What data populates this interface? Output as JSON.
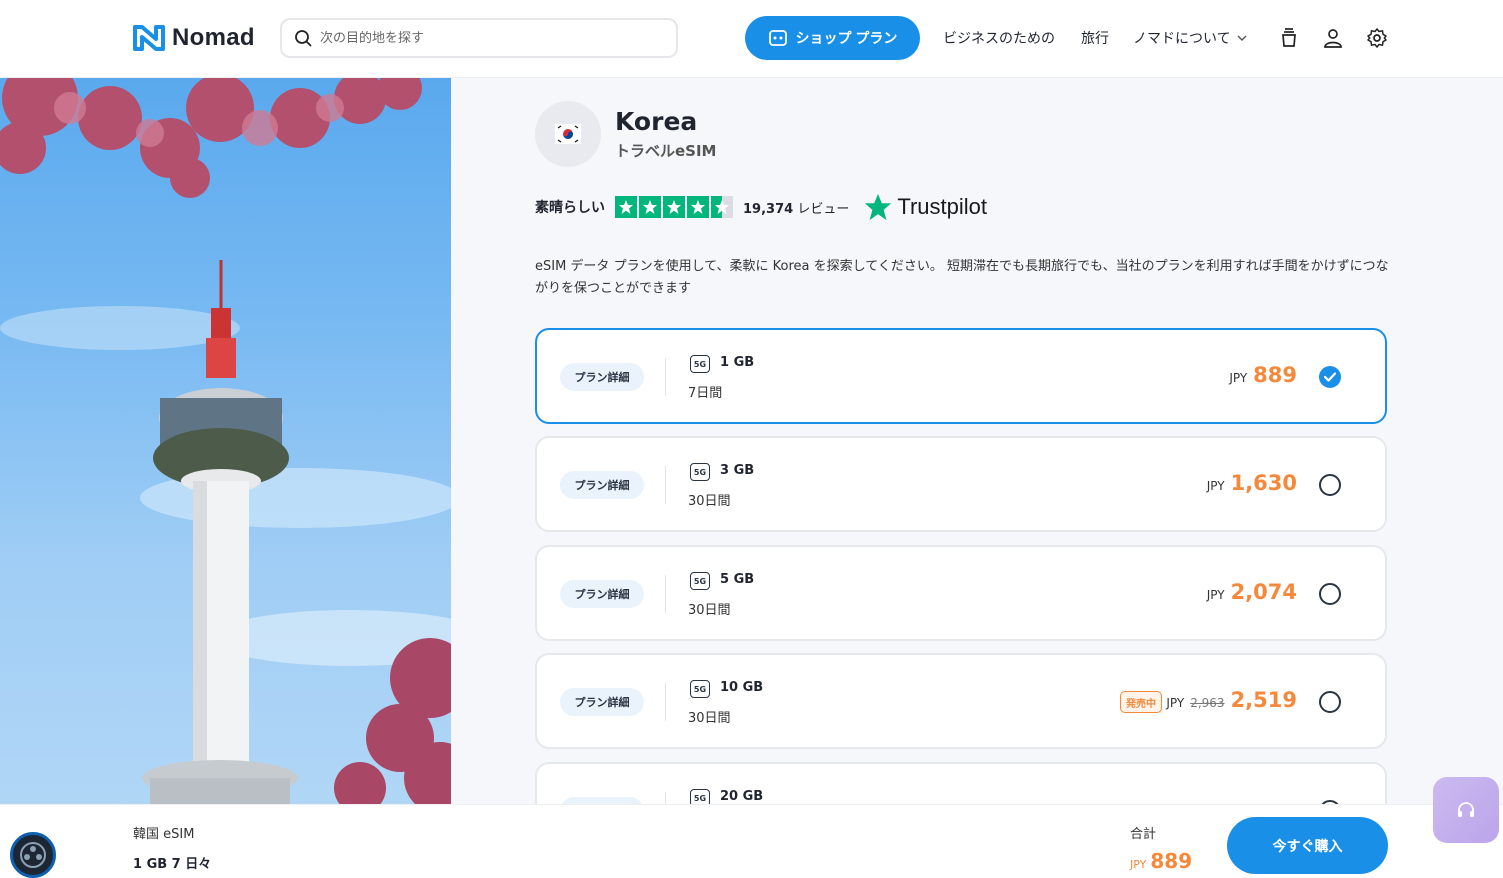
{
  "header": {
    "brand": "Nomad",
    "search_placeholder": "次の目的地を探す",
    "shop_plans_label": "ショップ プラン",
    "nav_business": "ビジネスのための",
    "nav_travel": "旅行",
    "nav_about": "ノマドについて"
  },
  "country": {
    "name": "Korea",
    "subtitle": "トラベルeSIM"
  },
  "rating": {
    "label": "素晴らしい",
    "stars": 4.5,
    "review_count": "19,374",
    "review_suffix": "レビュー",
    "provider": "Trustpilot"
  },
  "description": "eSIM データ プランを使用して、柔軟に Korea を探索してください。 短期滞在でも長期旅行でも、当社のプランを利用すれば手間をかけずにつながりを保つことができます",
  "plans": [
    {
      "detail_label": "プラン詳細",
      "network": "5G",
      "data": "1 GB",
      "validity": "7日間",
      "currency": "JPY",
      "price": "889",
      "old_price": "",
      "badge": "",
      "selected": true
    },
    {
      "detail_label": "プラン詳細",
      "network": "5G",
      "data": "3 GB",
      "validity": "30日間",
      "currency": "JPY",
      "price": "1,630",
      "old_price": "",
      "badge": "",
      "selected": false
    },
    {
      "detail_label": "プラン詳細",
      "network": "5G",
      "data": "5 GB",
      "validity": "30日間",
      "currency": "JPY",
      "price": "2,074",
      "old_price": "",
      "badge": "",
      "selected": false
    },
    {
      "detail_label": "プラン詳細",
      "network": "5G",
      "data": "10 GB",
      "validity": "30日間",
      "currency": "JPY",
      "price": "2,519",
      "old_price": "2,963",
      "badge": "発売中",
      "selected": false
    },
    {
      "detail_label": "プラン詳細",
      "network": "5G",
      "data": "20 GB",
      "validity": "",
      "currency": "",
      "price": "",
      "old_price": "",
      "badge": "",
      "selected": false
    }
  ],
  "bottom_bar": {
    "product": "韓国 eSIM",
    "selected_plan": "1 GB 7 日々",
    "total_label": "合計",
    "total_currency": "JPY",
    "total_price": "889",
    "buy_label": "今すぐ購入"
  },
  "colors": {
    "accent": "#1a8fe8",
    "price": "#f5883a",
    "trustpilot_green": "#00b67a"
  }
}
